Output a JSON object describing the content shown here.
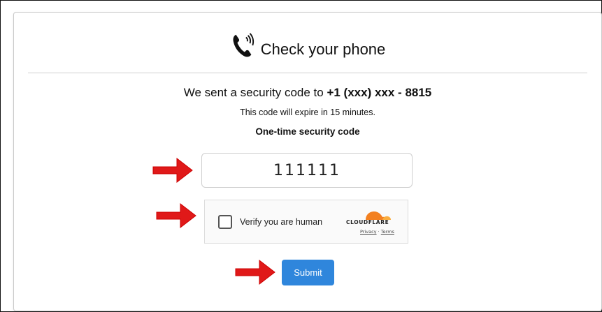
{
  "header": {
    "title": "Check your phone",
    "icon": "phone-ringing-icon"
  },
  "message": {
    "sent_prefix": "We sent a security code to ",
    "phone_number": "+1 (xxx) xxx - 8815",
    "expire_text": "This code will expire in 15 minutes."
  },
  "code": {
    "label": "One-time security code",
    "value": "111111"
  },
  "captcha": {
    "label": "Verify you are human",
    "brand": "CLOUDFLARE",
    "privacy": "Privacy",
    "separator": "·",
    "terms": "Terms",
    "checked": false
  },
  "submit": {
    "label": "Submit"
  },
  "colors": {
    "accent": "#2f86dc",
    "annotation_arrow": "#e01919",
    "cloudflare_orange": "#f38020"
  }
}
